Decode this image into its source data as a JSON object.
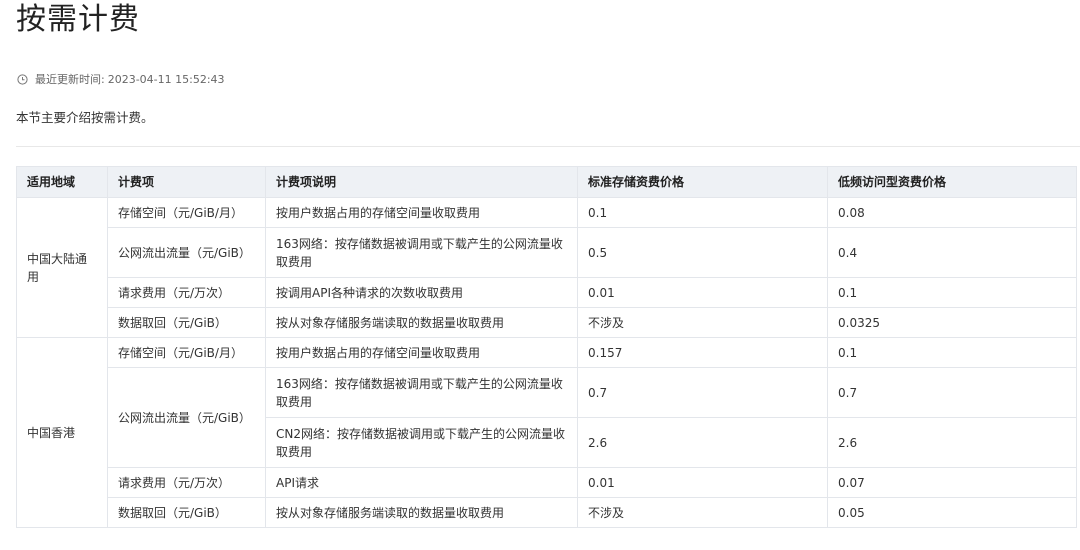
{
  "page": {
    "title": "按需计费",
    "update_label": "最近更新时间:",
    "update_time": "2023-04-11 15:52:43",
    "intro": "本节主要介绍按需计费。"
  },
  "table": {
    "headers": [
      "适用地域",
      "计费项",
      "计费项说明",
      "标准存储资费价格",
      "低频访问型资费价格"
    ],
    "regions": [
      {
        "name": "中国大陆通用",
        "rows": [
          {
            "item": "存储空间（元/GiB/月）",
            "desc": "按用户数据占用的存储空间量收取费用",
            "standard": "0.1",
            "low_freq": "0.08"
          },
          {
            "item": "公网流出流量（元/GiB）",
            "desc": "163网络：按存储数据被调用或下载产生的公网流量收取费用",
            "standard": "0.5",
            "low_freq": "0.4"
          },
          {
            "item": "请求费用（元/万次）",
            "desc": "按调用API各种请求的次数收取费用",
            "standard": "0.01",
            "low_freq": "0.1"
          },
          {
            "item": "数据取回（元/GiB）",
            "desc": "按从对象存储服务端读取的数据量收取费用",
            "standard": "不涉及",
            "low_freq": "0.0325"
          }
        ]
      },
      {
        "name": "中国香港",
        "rows": [
          {
            "item": "存储空间（元/GiB/月）",
            "desc": "按用户数据占用的存储空间量收取费用",
            "standard": "0.157",
            "low_freq": "0.1"
          },
          {
            "item": "公网流出流量（元/GiB）",
            "desc": "163网络：按存储数据被调用或下载产生的公网流量收取费用",
            "standard": "0.7",
            "low_freq": "0.7"
          },
          {
            "desc": "CN2网络：按存储数据被调用或下载产生的公网流量收取费用",
            "standard": "2.6",
            "low_freq": "2.6"
          },
          {
            "item": "请求费用（元/万次）",
            "desc": "API请求",
            "standard": "0.01",
            "low_freq": "0.07"
          },
          {
            "item": "数据取回（元/GiB）",
            "desc": "按从对象存储服务端读取的数据量收取费用",
            "standard": "不涉及",
            "low_freq": "0.05"
          }
        ]
      }
    ]
  }
}
